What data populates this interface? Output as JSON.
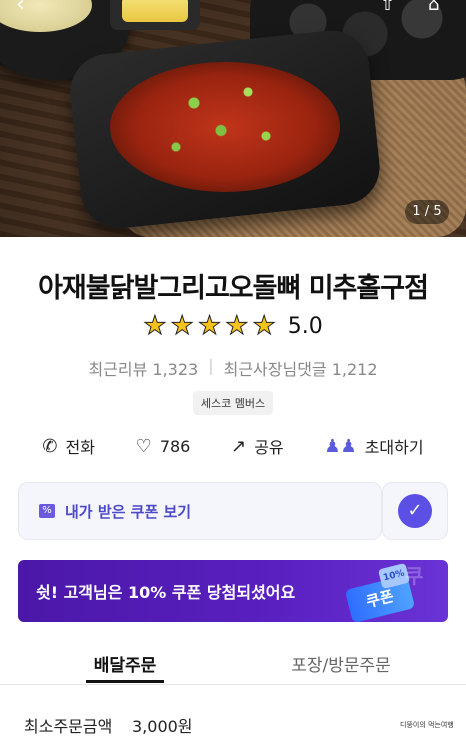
{
  "hero": {
    "image_counter": "1 / 5",
    "icons": [
      "back-icon",
      "share-icon",
      "home-icon"
    ]
  },
  "store": {
    "name": "아재불닭발그리고오돌뼈 미추홀구점",
    "rating": "5.0",
    "stars": 5,
    "recent_reviews_label": "최근리뷰 1,323",
    "recent_owner_replies_label": "최근사장님댓글 1,212",
    "badge": "세스코 멤버스"
  },
  "actions": {
    "call": "전화",
    "like_count": "786",
    "share": "공유",
    "invite": "초대하기"
  },
  "coupon": {
    "label": "내가 받은 쿠폰 보기"
  },
  "promo": {
    "text": "쉿! 고객님은 10% 쿠폰 당첨되셨어요",
    "ticket": "쿠폰",
    "percent": "10%"
  },
  "tabs": {
    "delivery": "배달주문",
    "pickup": "포장/방문주문",
    "active": "delivery"
  },
  "min_order": {
    "label": "최소주문금액",
    "value": "3,000원"
  },
  "watermark": "디뚱이의 먹는여행",
  "colors": {
    "accent": "#5b4fe6",
    "promo_bg": "#4b17a8",
    "star": "#f6c21b"
  }
}
